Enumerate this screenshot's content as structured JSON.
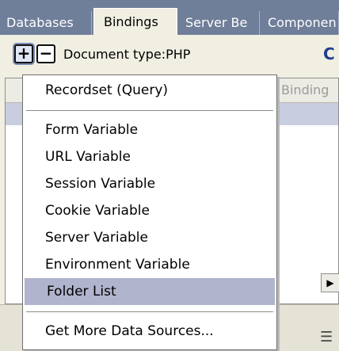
{
  "tabs": [
    {
      "label": "Databases"
    },
    {
      "label": "Bindings"
    },
    {
      "label": "Server Be"
    },
    {
      "label": "Componen"
    }
  ],
  "toolbar": {
    "plus_glyph": "+",
    "minus_glyph": "−",
    "document_type": "Document type:PHP",
    "refresh_glyph": "C"
  },
  "panel": {
    "column_binding": "Binding",
    "scroll_right_glyph": "▶",
    "list_icon_glyph": "☰"
  },
  "menu": {
    "items": [
      {
        "label": "Recordset (Query)"
      },
      {
        "label": "Form Variable"
      },
      {
        "label": "URL Variable"
      },
      {
        "label": "Session Variable"
      },
      {
        "label": "Cookie Variable"
      },
      {
        "label": "Server Variable"
      },
      {
        "label": "Environment Variable"
      },
      {
        "label": "Folder List",
        "highlighted": true
      },
      {
        "label": "Get More Data Sources..."
      }
    ]
  }
}
